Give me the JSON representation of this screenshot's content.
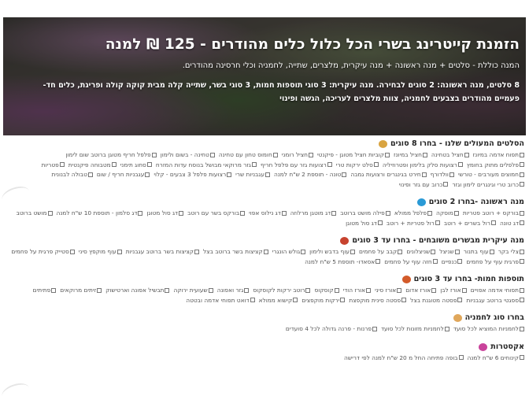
{
  "hero": {
    "title": "הזמנת קייטרינג בשרי הכל כלול כלים מהודרים - 125 ₪ למנה",
    "subtitle": "המנה כוללת - סלטים + מנה ראשונה + מנה עיקרית, מלצרים, שתייה, לחמניה וכלי חרסינה מהודרים.",
    "detail_line1": "8 סלטים, מנה ראשונה: 2 סוגים לבחירה. מנה עיקרית: 3 סוגי תוספות חמות, 3 סוגי בשר, שתייה קלה מבית קוקה קולה ופריגת, כלים חד-",
    "detail_line2": "פעמיים מהודרים בצבעים לחמניה, צוות מלצרים לעריכה, הגשה ופינוי"
  },
  "sections": [
    {
      "title": "הסלטים המעולים שלנו - בחרו 8 סוגים",
      "icon": "salad-bowl-icon",
      "icon_color": "#d9a441",
      "items": [
        "תפוח אדמה במיונז",
        "חציל בטחינה",
        "חציל במיונז",
        "קוביות חציל מטוגן - פיקנטי",
        "חציל רומני",
        "חומוס טחון עם טחינה",
        "טחינה - בשום ולימון",
        "פלפל חריף מטוגן ברוטב שום לימון",
        "פלפלים מתוק בחומץ",
        "רצועות סלק בלימון ופטרוזיליה",
        "סלט ירקות טרי",
        "רצועות גזר עם פלפל חריף",
        "גזר מרוקאי מבושל בנוסח עדות המזרח",
        "סחוג תימני",
        "מטבוחה פיקנטית",
        "פטריות",
        "חמוצים מעורבים - טורשי",
        "וולדורף",
        "חירט בגינגרים ורצועות גמבה",
        "טונה - תוספת 2 ש\"ח למנה",
        "עגבניות שרי",
        "רצועות פלפל 3 צבעים - קלוי",
        "עגבניות חריף / שום",
        "טבולה לבנונית",
        "כרוב טרי וגינגרים לימון וגזר",
        "כרוב עם גזר ופינוי"
      ]
    },
    {
      "title": "מנה ראשונה -בחרו 2 סוגים",
      "icon": "fish-icon",
      "icon_color": "#2a9ad6",
      "items": [
        "בורקס + רוטב פטריות",
        "מוסקה",
        "פלפל ממולא",
        "פילה מושט ברוטב",
        "דג מוטגן מרלוזה",
        "דג נילוס אפוי",
        "בורקס בשר עם רוטב",
        "דג סול מטוגן",
        "דג סלמון - תוספת 10 ש\"ח למנה",
        "מושט ברוטב",
        "דג טונה",
        "רול בשרים + רוטב",
        "רול פטריות + רוטב",
        "דג סול מטוגן"
      ]
    },
    {
      "title": "מנה עיקרית מבשרים משובחים - בחרו עד 3 סוגים",
      "icon": "meat-icon",
      "icon_color": "#c7432f",
      "items": [
        "צלי בקר",
        "עוף בתנור",
        "שניצל",
        "שניצלונים",
        "קבב על פחמים",
        "עוף בדבש ולימון",
        "גולש הונגרי",
        "קציצות בשר ברוטב בצל",
        "קציצות בשר ברוטב עגבניות",
        "עוף מוקפץ סיני",
        "סטייק פרגית על פחמים",
        "פרגית עוף על פחמים",
        "כנפיים",
        "חזה עוף על פחמים",
        "אסאדו- תוספת 5 ש\"ח למנה"
      ]
    },
    {
      "title": "תוספות חמות- בחרו עד 3 סוגים",
      "icon": "pot-icon",
      "icon_color": "#d35b2a",
      "items": [
        "תפוחי אדמה אפויים",
        "אורז לבן",
        "אורז אדום",
        "אורז סיני",
        "אורז הודי",
        "קוסקוס",
        "רוטב ירקות לקוסקוס",
        "גזר ואפונה",
        "שעועית ירוקה",
        "תבשיל אפונה וארטישוק",
        "זיתים מרוקאים",
        "פתיתים",
        "ספגטי ברוטב עגבניות",
        "פסטה מטוגנת בצל",
        "פסטה סינית מוקפצת",
        "ירקות מוקפצים",
        "קישוא ממולא",
        "דואט תפוחי אדמה ובטטה"
      ]
    },
    {
      "title": "בחרו סוג לחמניה",
      "icon": "bread-icon",
      "icon_color": "#e0a75b",
      "items": [
        "לחמניות המוציא לכל סועד",
        "לחמניות מזונות לכל סועד",
        "פרנות - פרנה גדולה לכל 4 סועדים"
      ]
    },
    {
      "title": "אקסטרות",
      "icon": "confetti-icon",
      "icon_color": "#c9439b",
      "items": [
        "קינוחים 6 ש\"ח למנה",
        "בופה פתיחה החל מ 20 ש\"ח למנה לפי דרישה"
      ]
    }
  ]
}
